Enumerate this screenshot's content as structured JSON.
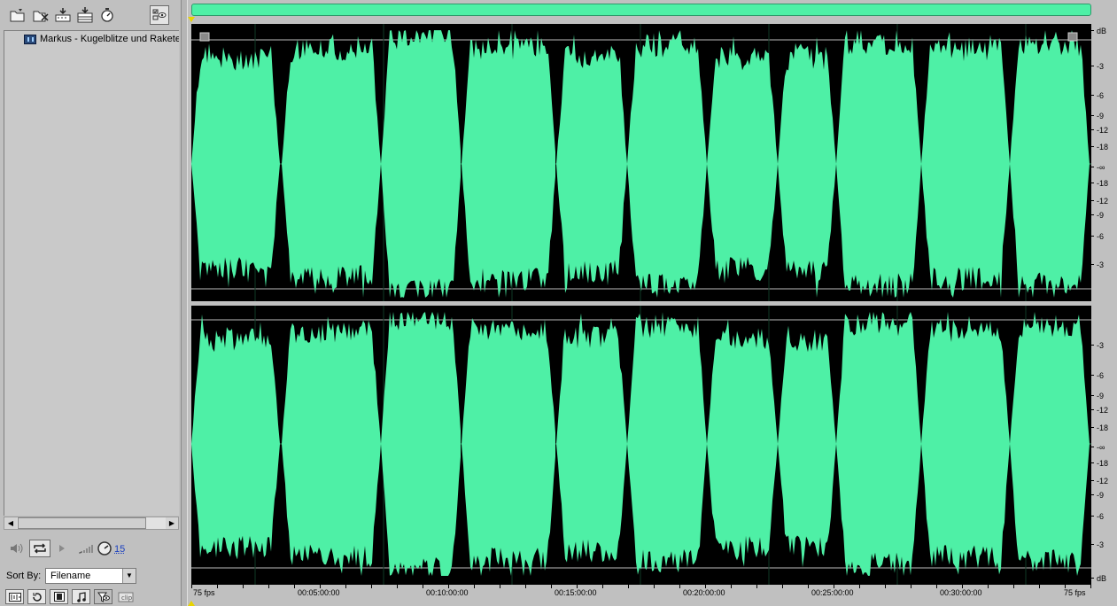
{
  "files_panel": {
    "toolbar_buttons": [
      {
        "name": "open-file-icon"
      },
      {
        "name": "close-file-icon"
      },
      {
        "name": "import-icon"
      },
      {
        "name": "insert-into-multitrack-icon"
      },
      {
        "name": "autoplay-icon"
      },
      {
        "name": "show-options-icon"
      }
    ],
    "files": [
      {
        "label": "Markus - Kugelblitze und Rakete",
        "icon": "waveform-file-icon"
      }
    ],
    "preview_count": "15",
    "sort_label": "Sort By:",
    "sort_value": "Filename"
  },
  "editor": {
    "db_labels_top": [
      "dB",
      "-3",
      "-6",
      "-9",
      "-12",
      "-18",
      "-∞",
      "-18",
      "-12",
      "-9",
      "-6",
      "-3"
    ],
    "db_labels_bottom": [
      "-3",
      "-6",
      "-9",
      "-12",
      "-18",
      "-∞",
      "-18",
      "-12",
      "-9",
      "-6",
      "-3",
      "dB"
    ],
    "time_labels": [
      "75 fps",
      "00:05:00:00",
      "00:10:00:00",
      "00:15:00:00",
      "00:20:00:00",
      "00:25:00:00",
      "00:30:00:00",
      "75 fps"
    ],
    "colors": {
      "waveform": "#4ef0a6",
      "background": "#000000",
      "overview": "#4ef0a6",
      "cursor": "#e8d400"
    }
  }
}
